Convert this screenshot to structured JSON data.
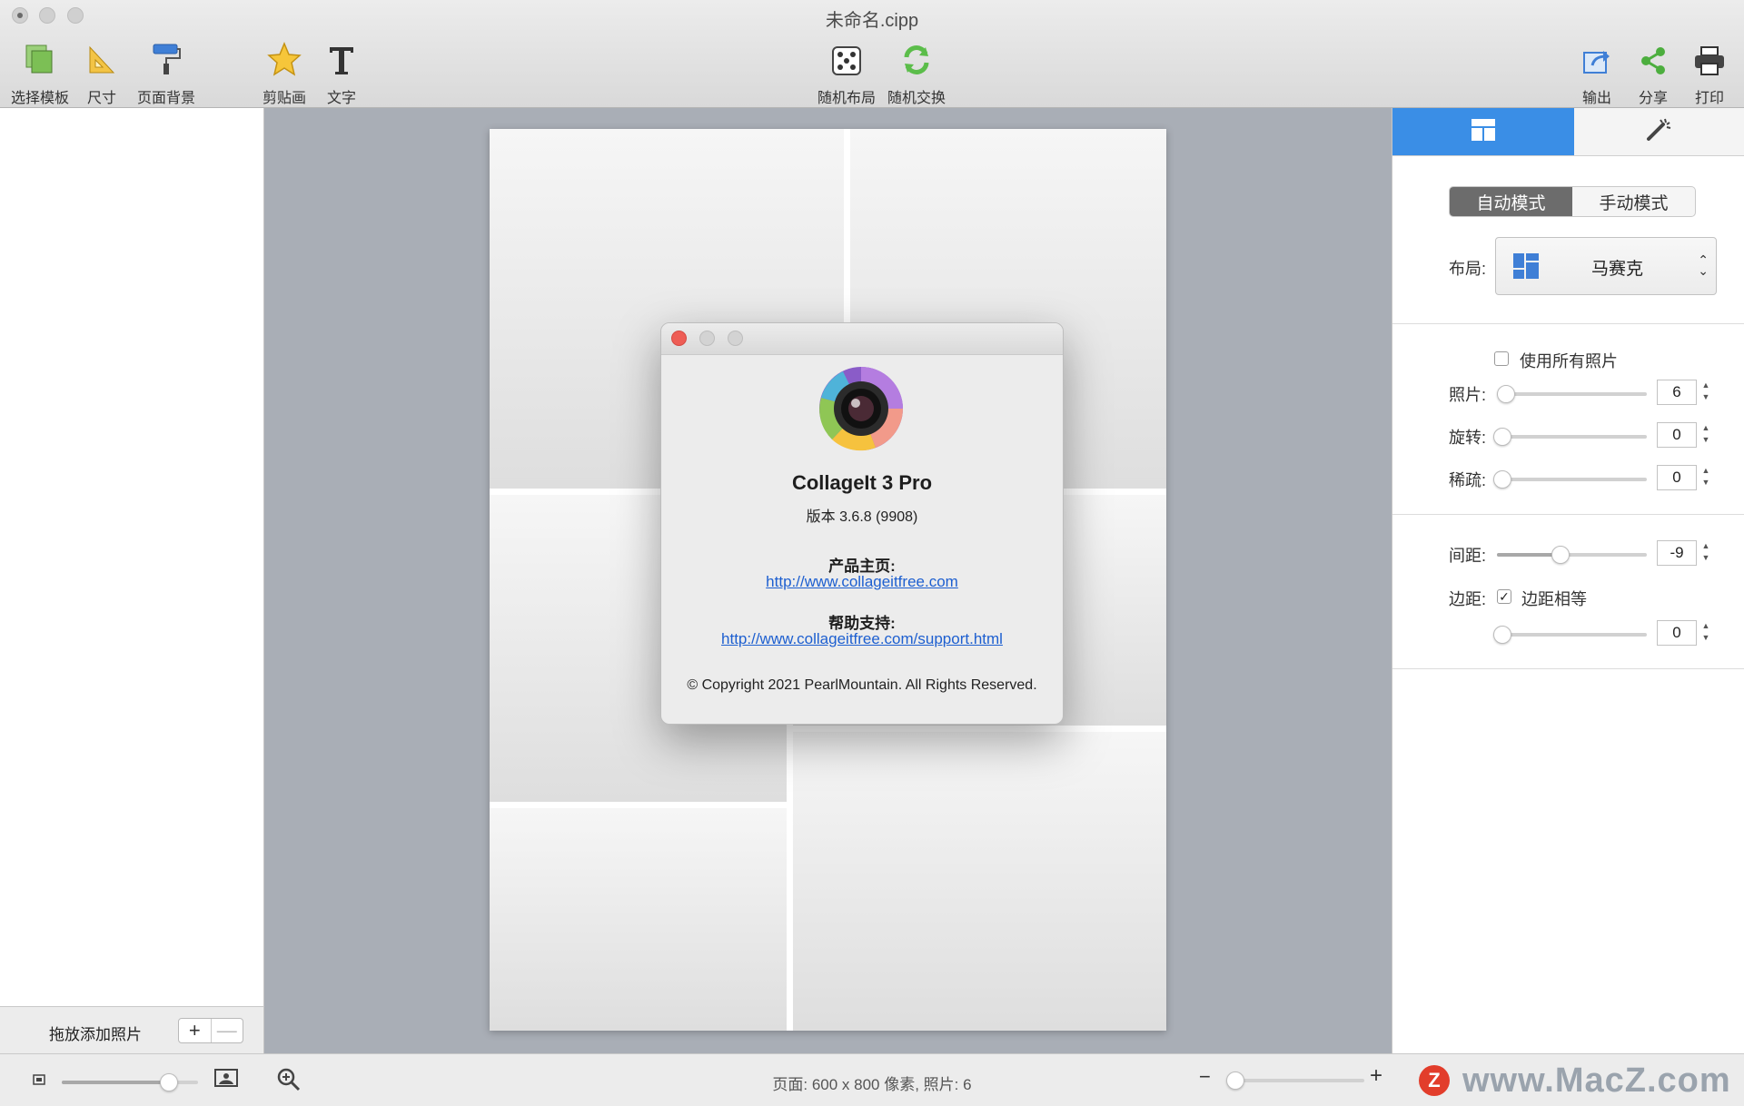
{
  "window": {
    "title": "未命名.cipp"
  },
  "toolbar": {
    "left": [
      {
        "label": "选择模板",
        "icon": "template-icon"
      },
      {
        "label": "尺寸",
        "icon": "ruler-icon"
      },
      {
        "label": "页面背景",
        "icon": "paint-roller-icon"
      },
      {
        "label": "剪贴画",
        "icon": "star-icon"
      },
      {
        "label": "文字",
        "icon": "text-icon"
      }
    ],
    "center": [
      {
        "label": "随机布局",
        "icon": "dice-icon"
      },
      {
        "label": "随机交换",
        "icon": "shuffle-icon"
      }
    ],
    "right": [
      {
        "label": "输出",
        "icon": "export-icon"
      },
      {
        "label": "分享",
        "icon": "share-icon"
      },
      {
        "label": "打印",
        "icon": "printer-icon"
      }
    ]
  },
  "left_panel": {
    "drop_hint": "拖放添加照片",
    "add_label": "+",
    "remove_label": "—"
  },
  "about": {
    "app_name": "CollageIt 3 Pro",
    "version": "版本 3.6.8 (9908)",
    "homepage_heading": "产品主页:",
    "homepage_url": "http://www.collageitfree.com",
    "support_heading": "帮助支持:",
    "support_url": "http://www.collageitfree.com/support.html",
    "copyright": "© Copyright 2021 PearlMountain. All Rights Reserved."
  },
  "right_panel": {
    "tabs": [
      {
        "icon": "layout-icon",
        "active": true
      },
      {
        "icon": "magic-wand-icon",
        "active": false
      }
    ],
    "mode": {
      "options": [
        "自动模式",
        "手动模式"
      ],
      "selected": "自动模式"
    },
    "layout": {
      "label": "布局:",
      "value": "马赛克"
    },
    "use_all_photos": {
      "label": "使用所有照片",
      "checked": false
    },
    "photos": {
      "label": "照片:",
      "value": "6",
      "slider_fraction": 0.05
    },
    "rotation": {
      "label": "旋转:",
      "value": "0",
      "slider_fraction": 0.0
    },
    "sparse": {
      "label": "稀疏:",
      "value": "0",
      "slider_fraction": 0.0
    },
    "spacing": {
      "label": "间距:",
      "value": "-9",
      "slider_fraction": 0.42
    },
    "margin": {
      "label": "边距:",
      "equal_label": "边距相等",
      "equal_checked": true,
      "value": "0",
      "slider_fraction": 0.0
    }
  },
  "statusbar": {
    "text": "页面: 600 x 800 像素, 照片: 6",
    "zoom_minus": "−",
    "zoom_plus": "+",
    "thumb_slider_fraction": 0.78,
    "zoom_slider_fraction": 0.05
  },
  "watermark": {
    "letter": "Z",
    "text": "www.MacZ.com"
  },
  "colors": {
    "accent": "#3a8ee6",
    "close_red": "#ee5d55",
    "link": "#1d5fd0"
  }
}
